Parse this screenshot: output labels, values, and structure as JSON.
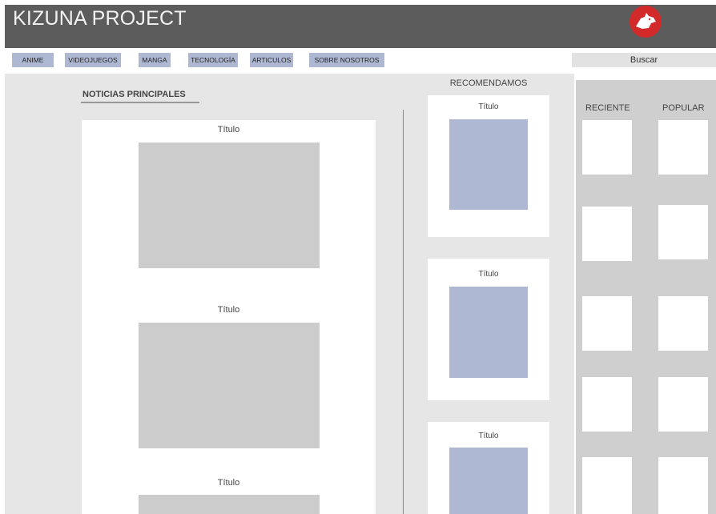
{
  "header": {
    "title": "KIZUNA PROJECT",
    "logo_icon": "wolf-logo-icon"
  },
  "nav": {
    "items": [
      "ANIME",
      "VIDEOJUEGOS",
      "MANGA",
      "TECNOLOGÍA",
      "ARTICULOS",
      "SOBRE NOSOTROS"
    ]
  },
  "search": {
    "placeholder": "Buscar"
  },
  "main": {
    "heading": "NOTICIAS PRINCIPALES",
    "news": [
      {
        "title": "Título"
      },
      {
        "title": "Título"
      },
      {
        "title": "Título"
      }
    ]
  },
  "recommended": {
    "heading": "RECOMENDAMOS",
    "items": [
      {
        "title": "Título"
      },
      {
        "title": "Título"
      },
      {
        "title": "Título"
      }
    ]
  },
  "sidebar": {
    "tabs": [
      "RECIENTE",
      "POPULAR"
    ]
  },
  "colors": {
    "header": "#5c5c5c",
    "accent": "#aeb8d2",
    "logo": "#d22a2a"
  }
}
